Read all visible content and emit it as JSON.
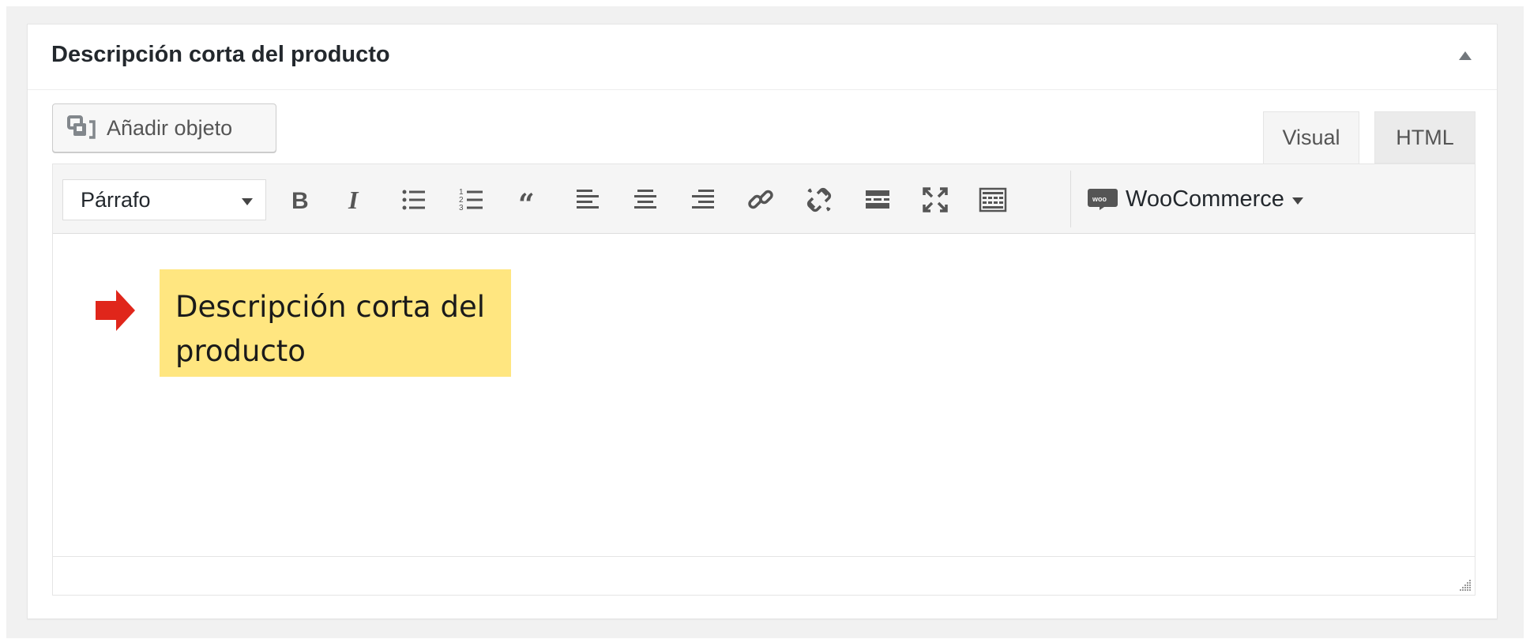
{
  "postbox": {
    "title": "Descripción corta del producto",
    "toggle_icon": "arrow-up-icon"
  },
  "media": {
    "add_button_label": "Añadir objeto",
    "icon": "add-media-icon"
  },
  "tabs": [
    {
      "label": "Visual",
      "active": true
    },
    {
      "label": "HTML",
      "active": false
    }
  ],
  "toolbar": {
    "format_select_value": "Párrafo",
    "buttons": [
      "bold-icon",
      "italic-icon",
      "bullet-list-icon",
      "numbered-list-icon",
      "blockquote-icon",
      "align-left-icon",
      "align-center-icon",
      "align-right-icon",
      "link-icon",
      "unlink-icon",
      "read-more-icon",
      "fullscreen-icon",
      "toolbar-toggle-icon"
    ],
    "woocommerce_label": "WooCommerce"
  },
  "annotation": {
    "text": "Descripción corta del producto",
    "note_color": "#ffe680",
    "arrow_color": "#e0261b"
  }
}
